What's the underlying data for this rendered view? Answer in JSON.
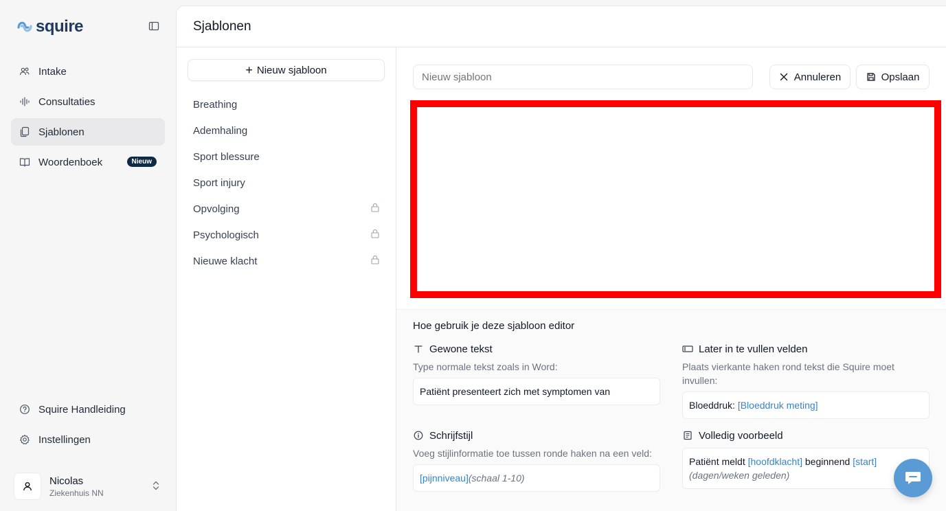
{
  "brand": {
    "name": "squire",
    "color": "#1e3a5f",
    "accent": "#5b9bd5"
  },
  "sidebar": {
    "items": [
      {
        "label": "Intake",
        "icon": "users-icon"
      },
      {
        "label": "Consultaties",
        "icon": "waveform-icon"
      },
      {
        "label": "Sjablonen",
        "icon": "file-copy-icon",
        "active": true
      },
      {
        "label": "Woordenboek",
        "icon": "book-icon",
        "badge": "Nieuw"
      }
    ],
    "bottom_items": [
      {
        "label": "Squire Handleiding",
        "icon": "help-circle-icon"
      },
      {
        "label": "Instellingen",
        "icon": "gear-icon"
      }
    ],
    "user": {
      "name": "Nicolas",
      "org": "Ziekenhuis NN"
    }
  },
  "main": {
    "title": "Sjablonen",
    "new_button": "Nieuw sjabloon",
    "templates": [
      {
        "label": "Breathing",
        "locked": false
      },
      {
        "label": "Ademhaling",
        "locked": false
      },
      {
        "label": "Sport blessure",
        "locked": false
      },
      {
        "label": "Sport injury",
        "locked": false
      },
      {
        "label": "Opvolging",
        "locked": true
      },
      {
        "label": "Psychologisch",
        "locked": true
      },
      {
        "label": "Nieuwe klacht",
        "locked": true
      }
    ],
    "editor": {
      "name_placeholder": "Nieuw sjabloon",
      "cancel_label": "Annuleren",
      "save_label": "Opslaan"
    },
    "help": {
      "title": "Hoe gebruik je deze sjabloon editor",
      "plain": {
        "title": "Gewone tekst",
        "desc": "Type normale tekst zoals in Word:",
        "example": "Patiënt presenteert zich met symptomen van"
      },
      "fields": {
        "title": "Later in te vullen velden",
        "desc": "Plaats vierkante haken rond tekst die Squire moet invullen:",
        "example_prefix": "Bloeddruk: ",
        "example_placeholder": "[Bloeddruk meting]"
      },
      "style": {
        "title": "Schrijfstijl",
        "desc": "Voeg stijlinformatie toe tussen ronde haken na een veld:",
        "example_placeholder": "[pijnniveau]",
        "example_style": "(schaal 1-10)"
      },
      "full": {
        "title": "Volledig voorbeeld",
        "part1": "Patiënt meldt ",
        "ph1": "[hoofdklacht]",
        "part2": " beginnend ",
        "ph2": "[start]",
        "style": "(dagen/weken geleden)"
      }
    }
  }
}
